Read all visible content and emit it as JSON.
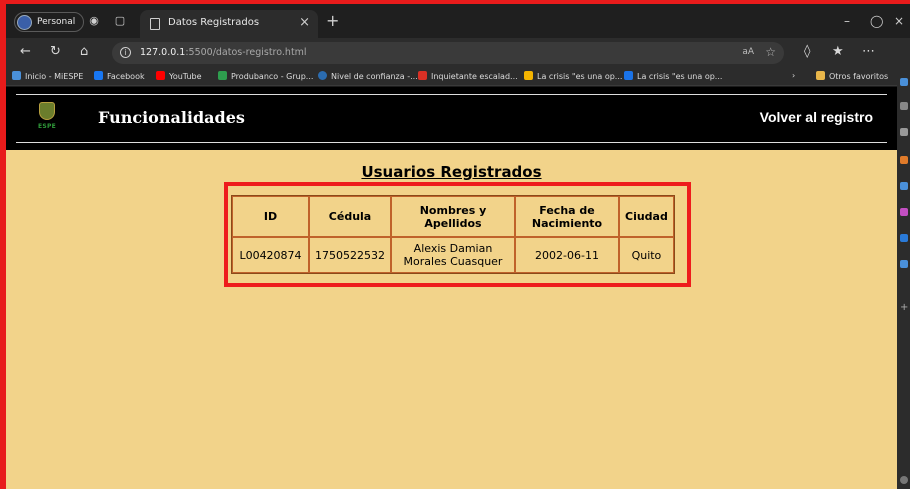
{
  "browser": {
    "profile": "Personal",
    "tab_title": "Datos Registrados",
    "url_host": "127.0.0.1",
    "url_path": ":5500/datos-registro.html",
    "read_aloud": "aA",
    "bookmarks": [
      {
        "label": "Inicio - MiESPE",
        "color": "#4a90d9"
      },
      {
        "label": "Facebook",
        "color": "#1877f2"
      },
      {
        "label": "YouTube",
        "color": "#ff0000"
      },
      {
        "label": "Produbanco - Grup...",
        "color": "#2e9e4e"
      },
      {
        "label": "Nivel de confianza -...",
        "color": "#2b6cb0"
      },
      {
        "label": "Inquietante escalad...",
        "color": "#d93025"
      },
      {
        "label": "La crisis \"es una op...",
        "color": "#f4b400"
      },
      {
        "label": "La crisis \"es una op...",
        "color": "#1a73e8"
      }
    ],
    "other_favorites": "Otros favoritos"
  },
  "site": {
    "logo_text": "ESPE",
    "title": "Funcionalidades",
    "back_link": "Volver al registro"
  },
  "main": {
    "heading": "Usuarios Registrados",
    "table": {
      "headers": [
        "ID",
        "Cédula",
        "Nombres y Apellidos",
        "Fecha de Nacimiento",
        "Ciudad"
      ],
      "rows": [
        [
          "L00420874",
          "1750522532",
          "Alexis Damian Morales Cuasquer",
          "2002-06-11",
          "Quito"
        ]
      ]
    }
  },
  "colors": {
    "page_background": "#f2d38a",
    "header_background": "#000000",
    "highlight": "#ee1c1c",
    "table_border": "#c0622a"
  }
}
